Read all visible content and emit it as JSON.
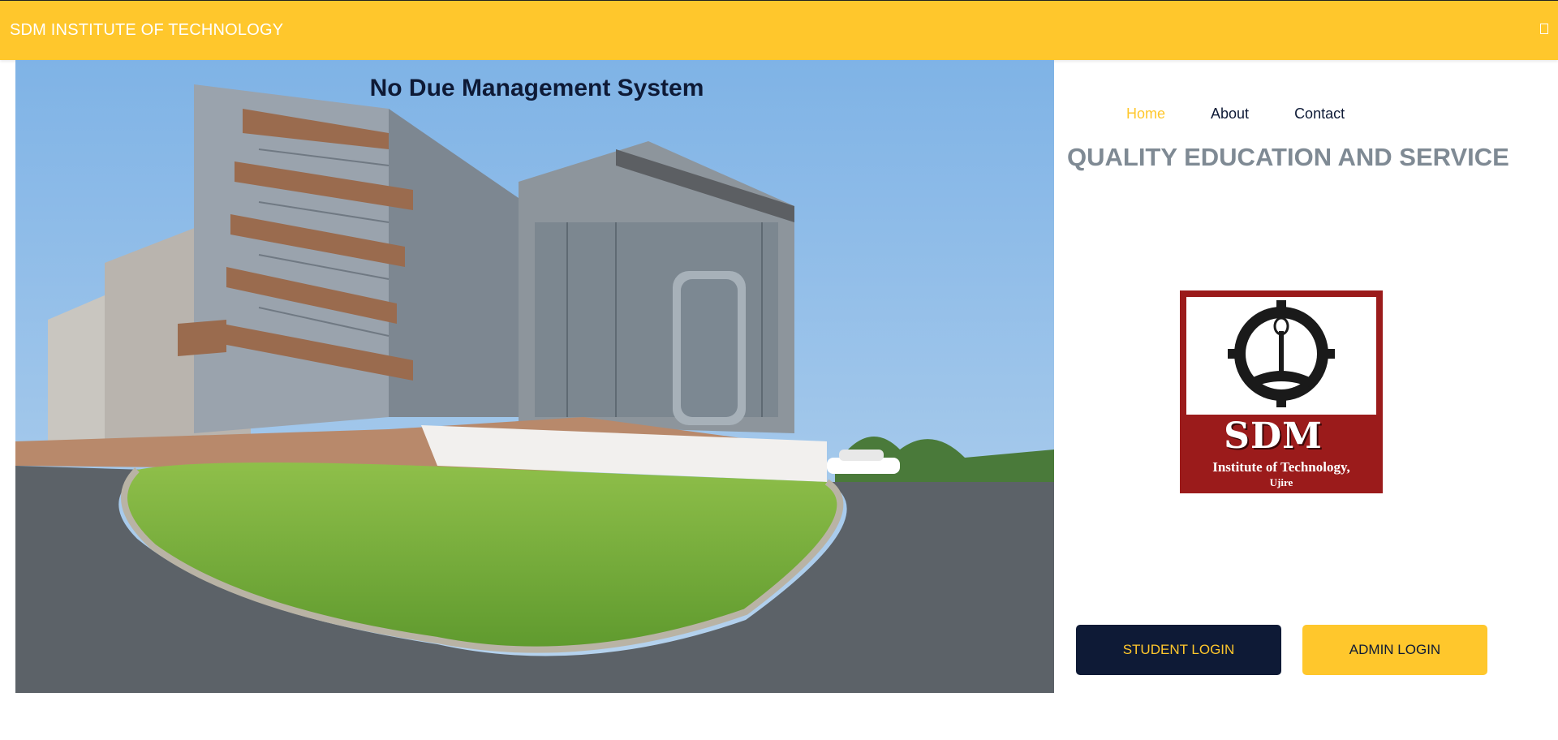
{
  "header": {
    "brand": "SDM INSTITUTE OF TECHNOLOGY",
    "menu_icon": "menu-toggle-icon"
  },
  "hero": {
    "title": "No Due Management System",
    "image_alt": "SDM Institute of Technology campus building"
  },
  "nav": {
    "items": [
      {
        "label": "Home",
        "active": true
      },
      {
        "label": "About",
        "active": false
      },
      {
        "label": "Contact",
        "active": false
      }
    ]
  },
  "tagline": "QUALITY EDUCATION AND SERVICE",
  "logo": {
    "name": "SDM",
    "subtitle": "Institute of Technology,",
    "place": "Ujire"
  },
  "buttons": {
    "student_login": "STUDENT LOGIN",
    "admin_login": "ADMIN LOGIN"
  },
  "colors": {
    "accent": "#ffc72c",
    "navy": "#0e1a36",
    "tagline": "#7f8a94",
    "logo_red": "#9b1b1b"
  }
}
